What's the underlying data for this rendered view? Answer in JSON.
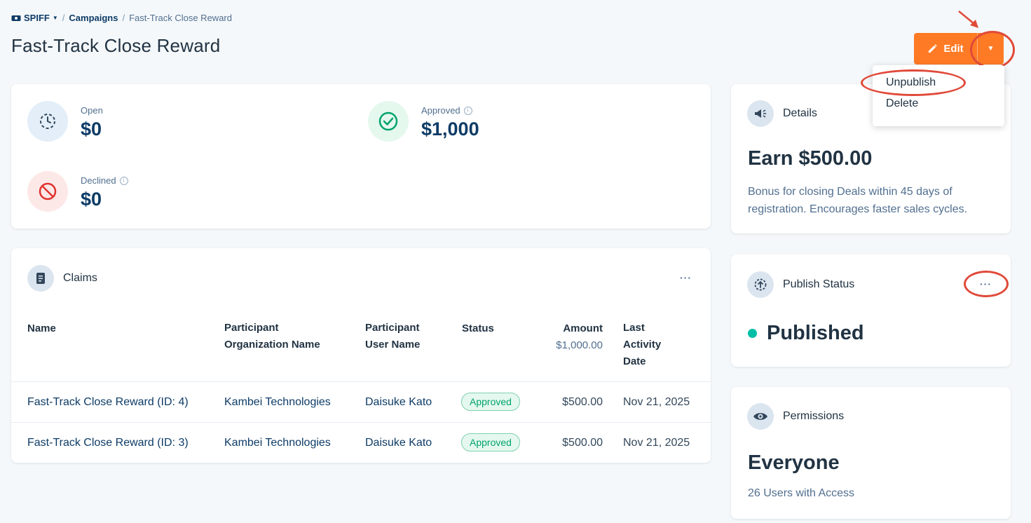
{
  "breadcrumb": {
    "root": "SPIFF",
    "campaigns": "Campaigns",
    "current": "Fast-Track Close Reward",
    "separator": "/"
  },
  "page_title": "Fast-Track Close Reward",
  "header": {
    "edit_label": "Edit",
    "accent_color": "#ff7a24"
  },
  "dropdown": {
    "items": [
      {
        "label": "Unpublish"
      },
      {
        "label": "Delete"
      }
    ]
  },
  "stats": {
    "open": {
      "label": "Open",
      "value": "$0"
    },
    "approved": {
      "label": "Approved",
      "value": "$1,000"
    },
    "declined": {
      "label": "Declined",
      "value": "$0"
    }
  },
  "claims": {
    "title": "Claims",
    "more": "···",
    "columns": {
      "name": "Name",
      "org_l1": "Participant",
      "org_l2": "Organization Name",
      "user_l1": "Participant",
      "user_l2": "User Name",
      "status": "Status",
      "amount": "Amount",
      "amount_total": "$1,000.00",
      "last_l1": "Last",
      "last_l2": "Activity",
      "last_l3": "Date"
    },
    "rows": [
      {
        "name": "Fast-Track Close Reward (ID: 4)",
        "org": "Kambei Technologies",
        "user": "Daisuke Kato",
        "status": "Approved",
        "amount": "$500.00",
        "date": "Nov 21, 2025"
      },
      {
        "name": "Fast-Track Close Reward (ID: 3)",
        "org": "Kambei Technologies",
        "user": "Daisuke Kato",
        "status": "Approved",
        "amount": "$500.00",
        "date": "Nov 21, 2025"
      }
    ]
  },
  "details": {
    "title": "Details",
    "earn": "Earn $500.00",
    "description": "Bonus for closing Deals within 45 days of registration. Encourages faster sales cycles."
  },
  "publish_status": {
    "title": "Publish Status",
    "more": "···",
    "status": "Published",
    "status_color": "#00bda5"
  },
  "permissions": {
    "title": "Permissions",
    "audience": "Everyone",
    "access_count": "26 Users with Access"
  }
}
